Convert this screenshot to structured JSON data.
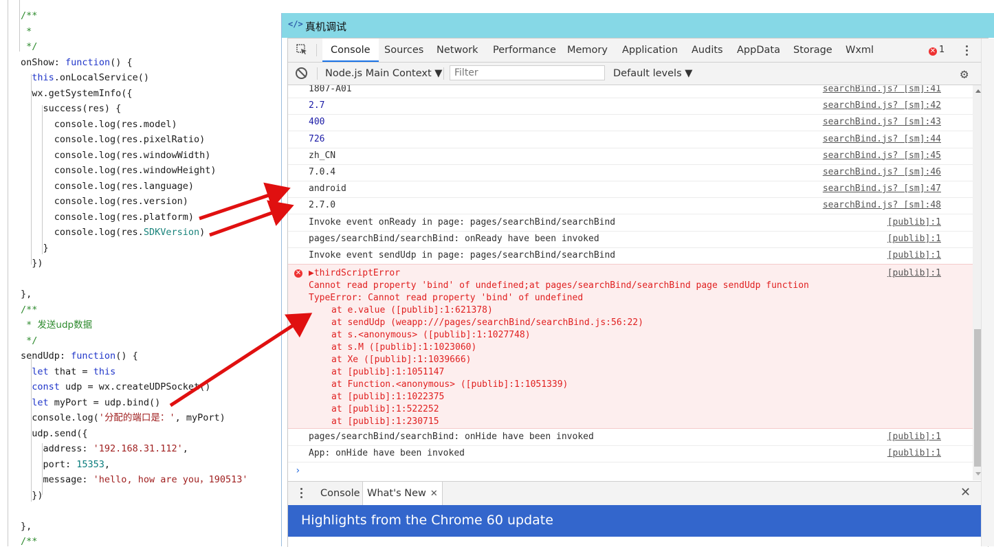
{
  "editor": {
    "lines": [
      [
        [
          "/**",
          "cm"
        ]
      ],
      [
        [
          " *",
          "cm"
        ]
      ],
      [
        [
          " */",
          "cm"
        ]
      ],
      [
        [
          "onShow",
          "t"
        ],
        [
          ": ",
          "t"
        ],
        [
          "function",
          "kw"
        ],
        [
          "() {",
          "t"
        ]
      ],
      [
        [
          "  ",
          "t"
        ],
        [
          "this",
          "kw"
        ],
        [
          ".onLocalService()",
          "t"
        ]
      ],
      [
        [
          "  wx.getSystemInfo({",
          "t"
        ]
      ],
      [
        [
          "    success(res) {",
          "t"
        ]
      ],
      [
        [
          "      console.log(res.model)",
          "t"
        ]
      ],
      [
        [
          "      console.log(res.pixelRatio)",
          "t"
        ]
      ],
      [
        [
          "      console.log(res.windowWidth)",
          "t"
        ]
      ],
      [
        [
          "      console.log(res.windowHeight)",
          "t"
        ]
      ],
      [
        [
          "      console.log(res.language)",
          "t"
        ]
      ],
      [
        [
          "      console.log(res.version)",
          "t"
        ]
      ],
      [
        [
          "      console.log(res.platform)",
          "t"
        ]
      ],
      [
        [
          "      console.log(res.",
          "t"
        ],
        [
          "SDKVersion",
          "tl"
        ],
        [
          ")",
          "t"
        ]
      ],
      [
        [
          "    }",
          "t"
        ]
      ],
      [
        [
          "  })",
          "t"
        ]
      ],
      [
        [
          "",
          "t"
        ]
      ],
      [
        [
          "},",
          "t"
        ]
      ],
      [
        [
          "/**",
          "cm"
        ]
      ],
      [
        [
          " * ",
          "cm"
        ],
        [
          "发送udp数据",
          "cmcn"
        ]
      ],
      [
        [
          " */",
          "cm"
        ]
      ],
      [
        [
          "sendUdp: ",
          "t"
        ],
        [
          "function",
          "kw"
        ],
        [
          "() {",
          "t"
        ]
      ],
      [
        [
          "  ",
          "t"
        ],
        [
          "let",
          "kw"
        ],
        [
          " that = ",
          "t"
        ],
        [
          "this",
          "kw"
        ]
      ],
      [
        [
          "  ",
          "t"
        ],
        [
          "const",
          "kw"
        ],
        [
          " udp = wx.createUDPSocket()",
          "t"
        ]
      ],
      [
        [
          "  ",
          "t"
        ],
        [
          "let",
          "kw"
        ],
        [
          " myPort = udp.bind()",
          "t"
        ]
      ],
      [
        [
          "  console.log(",
          "t"
        ],
        [
          "'",
          "str"
        ],
        [
          "分配的端口是：",
          "strcn"
        ],
        [
          "'",
          "str"
        ],
        [
          ", myPort)",
          "t"
        ]
      ],
      [
        [
          "  udp.send({",
          "t"
        ]
      ],
      [
        [
          "    address: ",
          "t"
        ],
        [
          "'192.168.31.112'",
          "str"
        ],
        [
          ",",
          "t"
        ]
      ],
      [
        [
          "    port: ",
          "t"
        ],
        [
          "15353",
          "num"
        ],
        [
          ",",
          "t"
        ]
      ],
      [
        [
          "    message: ",
          "t"
        ],
        [
          "'hello, how are you，190513'",
          "str"
        ]
      ],
      [
        [
          "  })",
          "t"
        ]
      ],
      [
        [
          "",
          "t"
        ]
      ],
      [
        [
          "},",
          "t"
        ]
      ],
      [
        [
          "/**",
          "cm"
        ]
      ]
    ]
  },
  "window": {
    "title": "真机调试",
    "title_icon": "code-icon"
  },
  "tabs": [
    "Console",
    "Sources",
    "Network",
    "Performance",
    "Memory",
    "Application",
    "Audits",
    "AppData",
    "Storage",
    "Wxml"
  ],
  "active_tab": "Console",
  "error_count": "1",
  "toolbar": {
    "context": "Node.js Main Context ▼",
    "filter_placeholder": "Filter",
    "levels": "Default levels ▼"
  },
  "console_rows": [
    {
      "msg": "1807-A01",
      "src": "searchBind.js? [sm]:41",
      "num": false
    },
    {
      "msg": "2.7",
      "src": "searchBind.js? [sm]:42",
      "num": true
    },
    {
      "msg": "400",
      "src": "searchBind.js? [sm]:43",
      "num": true
    },
    {
      "msg": "726",
      "src": "searchBind.js? [sm]:44",
      "num": true
    },
    {
      "msg": "zh_CN",
      "src": "searchBind.js? [sm]:45",
      "num": false
    },
    {
      "msg": "7.0.4",
      "src": "searchBind.js? [sm]:46",
      "num": false
    },
    {
      "msg": "android",
      "src": "searchBind.js? [sm]:47",
      "num": false
    },
    {
      "msg": "2.7.0",
      "src": "searchBind.js? [sm]:48",
      "num": false
    },
    {
      "msg": "Invoke event onReady in page: pages/searchBind/searchBind",
      "src": "[publib]:1",
      "num": false
    },
    {
      "msg": "pages/searchBind/searchBind: onReady have been invoked",
      "src": "[publib]:1",
      "num": false
    },
    {
      "msg": "Invoke event sendUdp in page: pages/searchBind/searchBind",
      "src": "[publib]:1",
      "num": false
    }
  ],
  "error": {
    "title": "▶thirdScriptError",
    "src": "[publib]:1",
    "lines": [
      "Cannot read property 'bind' of undefined;at pages/searchBind/searchBind page sendUdp function",
      "TypeError: Cannot read property 'bind' of undefined"
    ],
    "stack": [
      "at e.value ([publib]:1:621378)",
      "at sendUdp (weapp:///pages/searchBind/searchBind.js:56:22)",
      "at s.<anonymous> ([publib]:1:1027748)",
      "at s.M ([publib]:1:1023060)",
      "at Xe ([publib]:1:1039666)",
      "at [publib]:1:1051147",
      "at Function.<anonymous> ([publib]:1:1051339)",
      "at [publib]:1:1022375",
      "at [publib]:1:522252",
      "at [publib]:1:230715"
    ]
  },
  "after_rows": [
    {
      "msg": "pages/searchBind/searchBind: onHide have been invoked",
      "src": "[publib]:1"
    },
    {
      "msg": "App: onHide have been invoked",
      "src": "[publib]:1"
    }
  ],
  "prompt": "›",
  "drawer": {
    "tabs": [
      "Console",
      "What's New"
    ],
    "active": "What's New",
    "close": "✕"
  },
  "banner": "Highlights from the Chrome 60 update",
  "colors": {
    "title_bar": "#86d8e6",
    "error_bg": "#fdeeee",
    "error_text": "#e02020",
    "banner": "#3366cc",
    "arrow": "#e01010"
  }
}
